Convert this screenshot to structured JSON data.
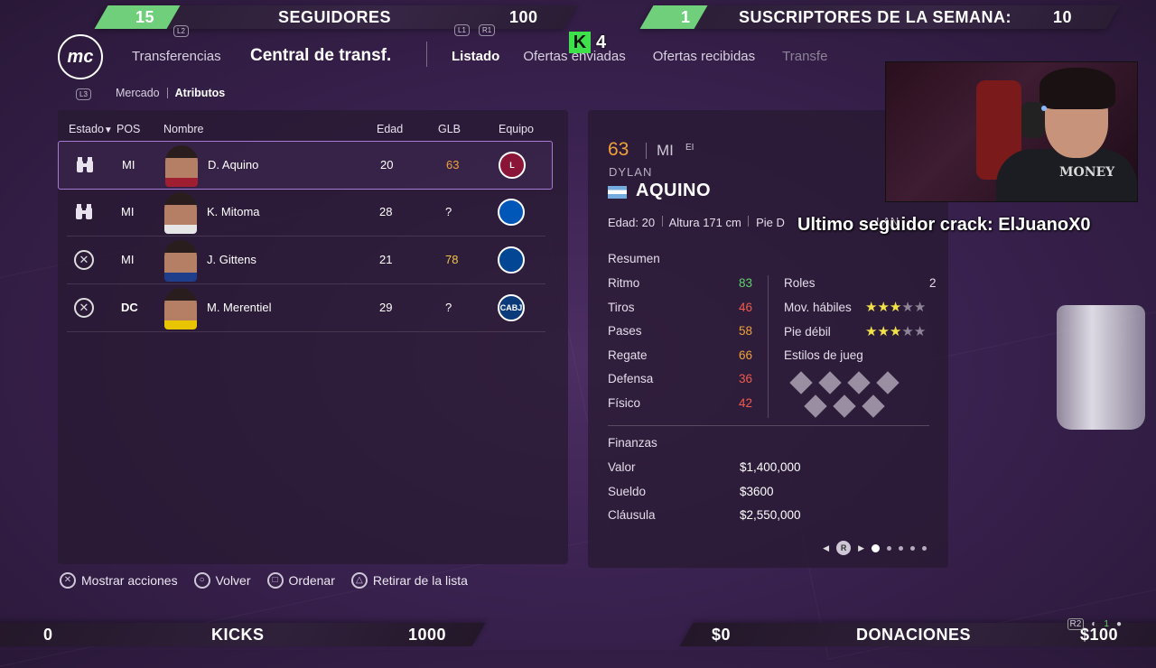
{
  "stream": {
    "followers": {
      "current": "15",
      "label": "SEGUIDORES",
      "goal": "100"
    },
    "subs": {
      "current": "1",
      "label": "SUSCRIPTORES DE LA SEMANA:",
      "goal": "10"
    },
    "kick_count": "4",
    "kicks": {
      "current": "0",
      "label": "KICKS",
      "goal": "1000"
    },
    "donations": {
      "current": "$0",
      "label": "DONACIONES",
      "goal": "$100"
    },
    "last_follower": "Ultimo seguidor crack: ElJuanoX0",
    "webcam_shirt_text": "MONEY"
  },
  "header": {
    "logo": "mc",
    "section": "Transferencias",
    "title": "Central de transf.",
    "tabs": [
      "Listado",
      "Ofertas enviadas",
      "Ofertas recibidas",
      "Transfe"
    ],
    "active_tab": "Listado",
    "l2": "L2",
    "l1": "L1",
    "r1": "R1",
    "l3": "L3",
    "subnav": [
      "Mercado",
      "Atributos"
    ],
    "subnav_active": "Atributos"
  },
  "table": {
    "headers": {
      "estado": "Estado",
      "pos": "POS",
      "nombre": "Nombre",
      "edad": "Edad",
      "glb": "GLB",
      "equipo": "Equipo"
    },
    "rows": [
      {
        "status_icon": "binoculars-icon",
        "pos": "MI",
        "name": "D. Aquino",
        "age": "20",
        "glb": "63",
        "glb_color": "#f0a23b",
        "team_icon": "lanus-crest-icon",
        "team_color": "#8a1538",
        "team_text": "L"
      },
      {
        "status_icon": "binoculars-icon",
        "pos": "MI",
        "name": "K. Mitoma",
        "age": "28",
        "glb": "?",
        "glb_color": "#ffffff",
        "team_icon": "brighton-crest-icon",
        "team_color": "#0057b8",
        "team_text": ""
      },
      {
        "status_icon": "cross-icon",
        "pos": "MI",
        "name": "J. Gittens",
        "age": "21",
        "glb": "78",
        "glb_color": "#f3c544",
        "team_icon": "chelsea-crest-icon",
        "team_color": "#034694",
        "team_text": ""
      },
      {
        "status_icon": "cross-icon",
        "pos": "DC",
        "name": "M. Merentiel",
        "age": "29",
        "glb": "?",
        "glb_color": "#ffffff",
        "team_icon": "boca-crest-icon",
        "team_color": "#0b3a7a",
        "team_text": "CABJ"
      }
    ]
  },
  "player": {
    "rating": "63",
    "pos": "MI",
    "alt_pos": "EI",
    "first_name": "DYLAN",
    "last_name": "AQUINO",
    "age_label": "Edad:",
    "age": "20",
    "height_label": "Altura",
    "height": "171 cm",
    "foot_label": "Pie",
    "foot": "D",
    "club_short": "LAN",
    "summary_title": "Resumen",
    "stats": [
      {
        "label": "Ritmo",
        "value": "83",
        "color": "#5fd36a"
      },
      {
        "label": "Tiros",
        "value": "46",
        "color": "#ef5b4c"
      },
      {
        "label": "Pases",
        "value": "58",
        "color": "#f0a23b"
      },
      {
        "label": "Regate",
        "value": "66",
        "color": "#f0a23b"
      },
      {
        "label": "Defensa",
        "value": "36",
        "color": "#ef5b4c"
      },
      {
        "label": "Físico",
        "value": "42",
        "color": "#ef5b4c"
      }
    ],
    "roles_label": "Roles",
    "roles": "2",
    "skill_moves_label": "Mov. hábiles",
    "skill_moves": 3,
    "weak_foot_label": "Pie débil",
    "weak_foot": 3,
    "styles_label": "Estilos de jueg",
    "finances_title": "Finanzas",
    "value_label": "Valor",
    "value": "$1,400,000",
    "wage_label": "Sueldo",
    "wage": "$3600",
    "clause_label": "Cláusula",
    "clause": "$2,550,000",
    "pager_button": "R"
  },
  "footer": {
    "hints": [
      {
        "icon": "cross-button-icon",
        "glyph": "✕",
        "label": "Mostrar acciones"
      },
      {
        "icon": "circle-button-icon",
        "glyph": "○",
        "label": "Volver"
      },
      {
        "icon": "square-button-icon",
        "glyph": "□",
        "label": "Ordenar"
      },
      {
        "icon": "triangle-button-icon",
        "glyph": "△",
        "label": "Retirar de la lista"
      }
    ],
    "r2": "R2",
    "player_count": "1"
  }
}
